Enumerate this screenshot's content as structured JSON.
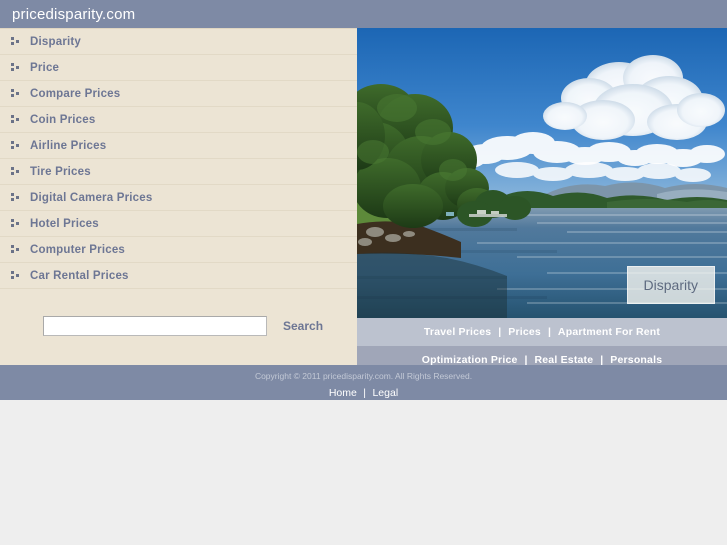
{
  "header": {
    "site_title": "pricedisparity.com",
    "bar_color": "#7e8aa5"
  },
  "sidebar": {
    "background": "#ece4d4",
    "bullet_icon": "three-squares-bullet-icon",
    "items": [
      {
        "label": "Disparity"
      },
      {
        "label": "Price"
      },
      {
        "label": "Compare Prices"
      },
      {
        "label": "Coin Prices"
      },
      {
        "label": "Airline Prices"
      },
      {
        "label": "Tire Prices"
      },
      {
        "label": "Digital Camera Prices"
      },
      {
        "label": "Hotel Prices"
      },
      {
        "label": "Computer Prices"
      },
      {
        "label": "Car Rental Prices"
      }
    ]
  },
  "search": {
    "value": "",
    "placeholder": "",
    "button_label": "Search"
  },
  "hero": {
    "alt": "lake-landscape-photo",
    "badge_label": "Disparity"
  },
  "linkbars": [
    {
      "background": "#bcc2cf",
      "links": [
        "Travel Prices",
        "Prices",
        "Apartment For Rent"
      ],
      "separator": "|"
    },
    {
      "background": "#a0a6b8",
      "links": [
        "Optimization Price",
        "Real Estate",
        "Personals"
      ],
      "separator": "|"
    }
  ],
  "footer": {
    "copyright": "Copyright © 2011 pricedisparity.com. All Rights Reserved.",
    "links": [
      "Home",
      "Legal"
    ],
    "separator": "|",
    "background": "#7e8aa5"
  }
}
